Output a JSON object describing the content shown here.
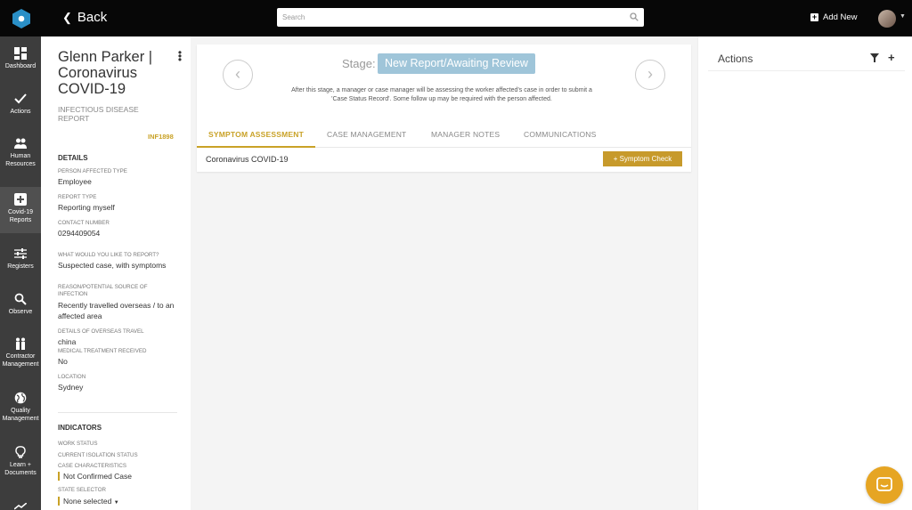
{
  "topbar": {
    "back_label": "Back",
    "search_placeholder": "Search",
    "add_new_label": "Add New"
  },
  "nav": {
    "items": [
      {
        "label1": "Dashboard",
        "label2": "",
        "icon": "grid-icon"
      },
      {
        "label1": "Actions",
        "label2": "",
        "icon": "check-icon"
      },
      {
        "label1": "Human",
        "label2": "Resources",
        "icon": "people-icon"
      },
      {
        "label1": "Covid-19",
        "label2": "Reports",
        "icon": "plus-box-icon"
      },
      {
        "label1": "Registers",
        "label2": "",
        "icon": "sliders-icon"
      },
      {
        "label1": "Observe",
        "label2": "",
        "icon": "search-icon"
      },
      {
        "label1": "Contractor",
        "label2": "Management",
        "icon": "workers-icon"
      },
      {
        "label1": "Quality",
        "label2": "Management",
        "icon": "globe-icon"
      },
      {
        "label1": "Learn +",
        "label2": "Documents",
        "icon": "bulb-icon"
      }
    ]
  },
  "detail": {
    "title": "Glenn Parker | Coronavirus COVID-19",
    "subtitle": "INFECTIOUS DISEASE REPORT",
    "ref": "INF1898",
    "details_heading": "DETAILS",
    "fields": [
      {
        "label": "PERSON AFFECTED TYPE",
        "value": "Employee"
      },
      {
        "label": "REPORT TYPE",
        "value": "Reporting myself"
      },
      {
        "label": "CONTACT NUMBER",
        "value": "0294409054"
      },
      {
        "label": "WHAT WOULD YOU LIKE TO REPORT?",
        "value": "Suspected case, with symptoms"
      },
      {
        "label": "REASON/POTENTIAL SOURCE OF INFECTION",
        "value": "Recently travelled overseas / to an affected area"
      },
      {
        "label": "DETAILS OF OVERSEAS TRAVEL",
        "value": "china"
      },
      {
        "label": "MEDICAL TREATMENT RECEIVED",
        "value": "No"
      },
      {
        "label": "LOCATION",
        "value": "Sydney"
      }
    ],
    "indicators_heading": "INDICATORS",
    "indicators": {
      "work_status": "WORK STATUS",
      "isolation_status": "CURRENT ISOLATION STATUS",
      "case_characteristics": "CASE CHARACTERISTICS",
      "case_value": "Not Confirmed Case",
      "state_selector": "STATE SELECTOR",
      "state_value": "None selected"
    }
  },
  "stage": {
    "label": "Stage:",
    "name": "New Report/Awaiting Review",
    "description": "After this stage, a manager or case manager will be assessing the worker affected's case in order to submit a 'Case Status Record'. Some follow up may be required with the person affected."
  },
  "tabs": [
    {
      "label": "SYMPTOM ASSESSMENT",
      "active": true
    },
    {
      "label": "CASE MANAGEMENT",
      "active": false
    },
    {
      "label": "MANAGER NOTES",
      "active": false
    },
    {
      "label": "COMMUNICATIONS",
      "active": false
    }
  ],
  "symptom": {
    "name": "Coronavirus COVID-19",
    "button_label": "+ Symptom Check"
  },
  "actions_panel": {
    "title": "Actions"
  },
  "colors": {
    "accent": "#c9a227",
    "stage_pill": "#9fc5d9",
    "nav_bg": "#3d3d3d",
    "topbar_bg": "#070707",
    "chat_button": "#e6a523"
  }
}
